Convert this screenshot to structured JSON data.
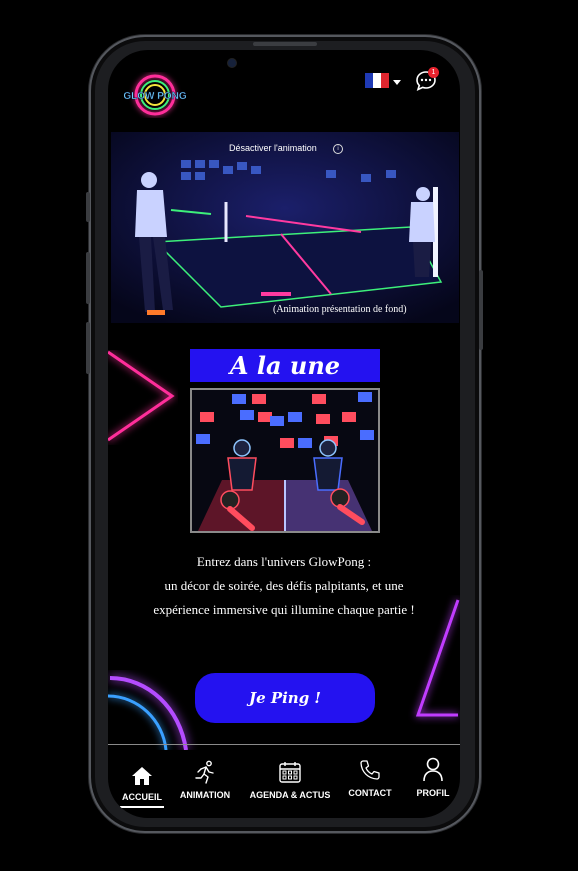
{
  "header": {
    "logo_text": "GLOW PONG",
    "language": "FR",
    "chat_badge": "1"
  },
  "hero": {
    "toggle_label": "Désactiver l'animation",
    "caption": "(Animation présentation de fond)"
  },
  "featured": {
    "title": "A la une"
  },
  "intro": {
    "line1": "Entrez dans l'univers GlowPong :",
    "line2": "un décor de soirée, des défis palpitants, et une",
    "line3": "expérience immersive qui illumine chaque partie !"
  },
  "cta": {
    "label": "Je Ping !"
  },
  "nav": {
    "items": [
      {
        "label": "ACCUEIL",
        "icon": "home-icon"
      },
      {
        "label": "ANIMATION",
        "icon": "running-icon"
      },
      {
        "label": "AGENDA & ACTUS",
        "icon": "calendar-icon"
      },
      {
        "label": "CONTACT",
        "icon": "phone-icon"
      },
      {
        "label": "PROFIL",
        "icon": "user-icon"
      }
    ]
  },
  "colors": {
    "accent": "#2412f0",
    "badge": "#e8232e",
    "neon_pink": "#ff2e9a",
    "neon_purple": "#c03cff"
  }
}
